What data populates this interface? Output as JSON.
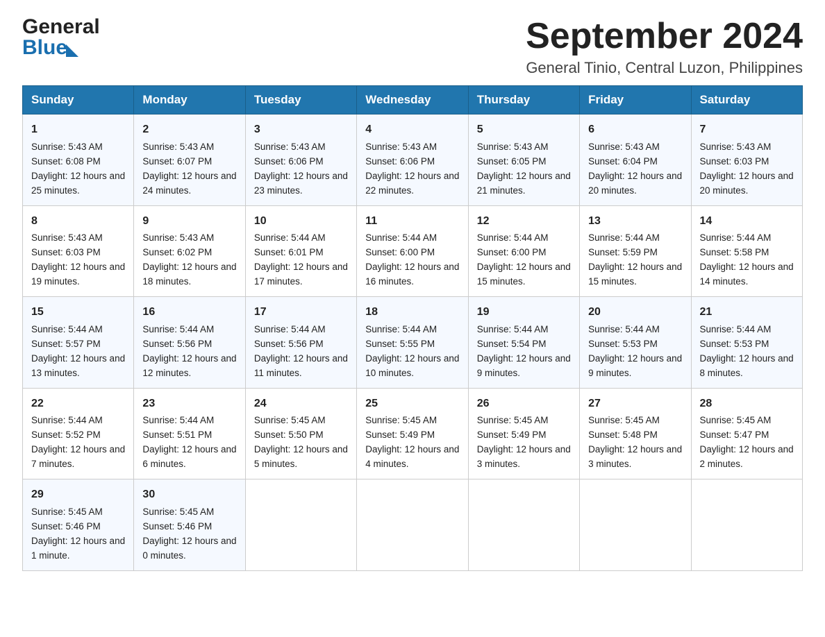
{
  "logo": {
    "line1": "General",
    "line2": "Blue"
  },
  "title": {
    "month": "September 2024",
    "location": "General Tinio, Central Luzon, Philippines"
  },
  "weekdays": [
    "Sunday",
    "Monday",
    "Tuesday",
    "Wednesday",
    "Thursday",
    "Friday",
    "Saturday"
  ],
  "weeks": [
    [
      {
        "day": "1",
        "sunrise": "5:43 AM",
        "sunset": "6:08 PM",
        "daylight": "12 hours and 25 minutes."
      },
      {
        "day": "2",
        "sunrise": "5:43 AM",
        "sunset": "6:07 PM",
        "daylight": "12 hours and 24 minutes."
      },
      {
        "day": "3",
        "sunrise": "5:43 AM",
        "sunset": "6:06 PM",
        "daylight": "12 hours and 23 minutes."
      },
      {
        "day": "4",
        "sunrise": "5:43 AM",
        "sunset": "6:06 PM",
        "daylight": "12 hours and 22 minutes."
      },
      {
        "day": "5",
        "sunrise": "5:43 AM",
        "sunset": "6:05 PM",
        "daylight": "12 hours and 21 minutes."
      },
      {
        "day": "6",
        "sunrise": "5:43 AM",
        "sunset": "6:04 PM",
        "daylight": "12 hours and 20 minutes."
      },
      {
        "day": "7",
        "sunrise": "5:43 AM",
        "sunset": "6:03 PM",
        "daylight": "12 hours and 20 minutes."
      }
    ],
    [
      {
        "day": "8",
        "sunrise": "5:43 AM",
        "sunset": "6:03 PM",
        "daylight": "12 hours and 19 minutes."
      },
      {
        "day": "9",
        "sunrise": "5:43 AM",
        "sunset": "6:02 PM",
        "daylight": "12 hours and 18 minutes."
      },
      {
        "day": "10",
        "sunrise": "5:44 AM",
        "sunset": "6:01 PM",
        "daylight": "12 hours and 17 minutes."
      },
      {
        "day": "11",
        "sunrise": "5:44 AM",
        "sunset": "6:00 PM",
        "daylight": "12 hours and 16 minutes."
      },
      {
        "day": "12",
        "sunrise": "5:44 AM",
        "sunset": "6:00 PM",
        "daylight": "12 hours and 15 minutes."
      },
      {
        "day": "13",
        "sunrise": "5:44 AM",
        "sunset": "5:59 PM",
        "daylight": "12 hours and 15 minutes."
      },
      {
        "day": "14",
        "sunrise": "5:44 AM",
        "sunset": "5:58 PM",
        "daylight": "12 hours and 14 minutes."
      }
    ],
    [
      {
        "day": "15",
        "sunrise": "5:44 AM",
        "sunset": "5:57 PM",
        "daylight": "12 hours and 13 minutes."
      },
      {
        "day": "16",
        "sunrise": "5:44 AM",
        "sunset": "5:56 PM",
        "daylight": "12 hours and 12 minutes."
      },
      {
        "day": "17",
        "sunrise": "5:44 AM",
        "sunset": "5:56 PM",
        "daylight": "12 hours and 11 minutes."
      },
      {
        "day": "18",
        "sunrise": "5:44 AM",
        "sunset": "5:55 PM",
        "daylight": "12 hours and 10 minutes."
      },
      {
        "day": "19",
        "sunrise": "5:44 AM",
        "sunset": "5:54 PM",
        "daylight": "12 hours and 9 minutes."
      },
      {
        "day": "20",
        "sunrise": "5:44 AM",
        "sunset": "5:53 PM",
        "daylight": "12 hours and 9 minutes."
      },
      {
        "day": "21",
        "sunrise": "5:44 AM",
        "sunset": "5:53 PM",
        "daylight": "12 hours and 8 minutes."
      }
    ],
    [
      {
        "day": "22",
        "sunrise": "5:44 AM",
        "sunset": "5:52 PM",
        "daylight": "12 hours and 7 minutes."
      },
      {
        "day": "23",
        "sunrise": "5:44 AM",
        "sunset": "5:51 PM",
        "daylight": "12 hours and 6 minutes."
      },
      {
        "day": "24",
        "sunrise": "5:45 AM",
        "sunset": "5:50 PM",
        "daylight": "12 hours and 5 minutes."
      },
      {
        "day": "25",
        "sunrise": "5:45 AM",
        "sunset": "5:49 PM",
        "daylight": "12 hours and 4 minutes."
      },
      {
        "day": "26",
        "sunrise": "5:45 AM",
        "sunset": "5:49 PM",
        "daylight": "12 hours and 3 minutes."
      },
      {
        "day": "27",
        "sunrise": "5:45 AM",
        "sunset": "5:48 PM",
        "daylight": "12 hours and 3 minutes."
      },
      {
        "day": "28",
        "sunrise": "5:45 AM",
        "sunset": "5:47 PM",
        "daylight": "12 hours and 2 minutes."
      }
    ],
    [
      {
        "day": "29",
        "sunrise": "5:45 AM",
        "sunset": "5:46 PM",
        "daylight": "12 hours and 1 minute."
      },
      {
        "day": "30",
        "sunrise": "5:45 AM",
        "sunset": "5:46 PM",
        "daylight": "12 hours and 0 minutes."
      },
      null,
      null,
      null,
      null,
      null
    ]
  ],
  "labels": {
    "sunrise": "Sunrise:",
    "sunset": "Sunset:",
    "daylight": "Daylight:"
  }
}
